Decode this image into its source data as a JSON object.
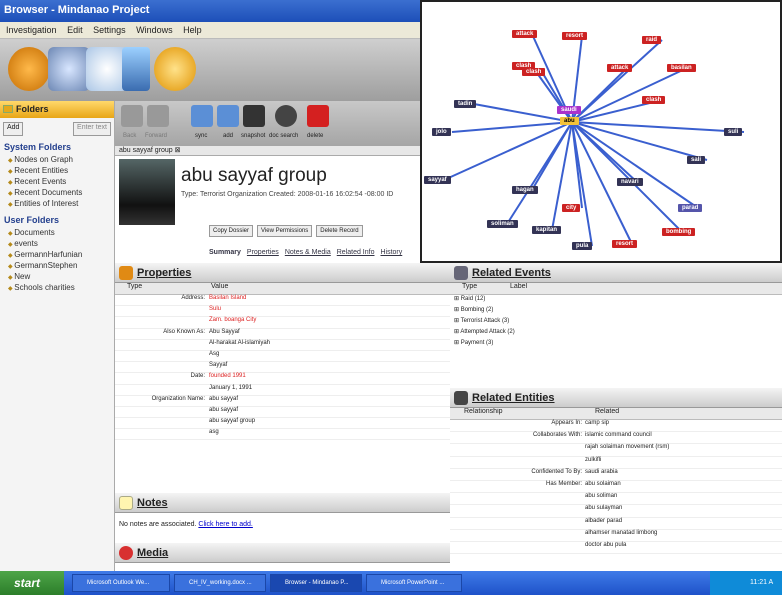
{
  "window": {
    "title": "Browser - Mindanao Project"
  },
  "menu": [
    "Investigation",
    "Edit",
    "Settings",
    "Windows",
    "Help"
  ],
  "sidebar": {
    "header": "Folders",
    "add_label": "Add",
    "filter_placeholder": "Enter text",
    "system_title": "System Folders",
    "system_items": [
      "Nodes on Graph",
      "Recent Entities",
      "Recent Events",
      "Recent Documents",
      "Entities of Interest"
    ],
    "user_title": "User Folders",
    "user_items": [
      "Documents",
      "events",
      "GermannHarfunian",
      "GermannStephen",
      "New",
      "Schools charities"
    ]
  },
  "detail": {
    "toolbar": [
      "Back",
      "Forward",
      "sync",
      "add",
      "snapshot",
      "doc search",
      "delete"
    ],
    "tab": "abu sayyaf group",
    "title": "abu sayyaf group",
    "meta": "Type: Terrorist Organization   Created: 2008-01-16 16:02:54 -08:00   ID",
    "buttons": [
      "Copy Dossier",
      "View Permissions",
      "Delete Record"
    ],
    "tabs": [
      "Summary",
      "Properties",
      "Notes & Media",
      "Related Info",
      "History"
    ]
  },
  "properties": {
    "title": "Properties",
    "columns": [
      "Type",
      "Value"
    ],
    "rows": [
      [
        "Address:",
        "Basilan Island",
        true
      ],
      [
        "",
        "Sulu",
        true
      ],
      [
        "",
        "Zam. boanga City",
        true
      ],
      [
        "Also Known As:",
        "Abu Sayyaf",
        false
      ],
      [
        "",
        "Al-harakat Al-islamiyah",
        false
      ],
      [
        "",
        "Asg",
        false
      ],
      [
        "",
        "Sayyaf",
        false
      ],
      [
        "Date:",
        "founded 1991",
        true
      ],
      [
        "",
        "January 1, 1991",
        false
      ],
      [
        "Organization Name:",
        "abu sayyaf",
        false
      ],
      [
        "",
        "abu sayyaf",
        false
      ],
      [
        "",
        "abu sayyaf group",
        false
      ],
      [
        "",
        "asg",
        false
      ]
    ]
  },
  "notes": {
    "title": "Notes",
    "text": "No notes are associated.",
    "link": "Click here to add."
  },
  "media": {
    "title": "Media"
  },
  "events": {
    "title": "Related Events",
    "columns": [
      "Type",
      "Label"
    ],
    "rows": [
      "Raid (12)",
      "Bombing (2)",
      "Terrorist Attack (3)",
      "Attempted Attack (2)",
      "Payment (3)"
    ]
  },
  "entities": {
    "title": "Related Entities",
    "columns": [
      "Relationship",
      "Related"
    ],
    "rows": [
      [
        "Appears In:",
        "camp sip"
      ],
      [
        "Collaborates With:",
        "islamic command council"
      ],
      [
        "",
        "rajah solaiman movement (rsm)"
      ],
      [
        "",
        "zulkifli"
      ],
      [
        "Confidented To By:",
        "saudi arabia"
      ],
      [
        "Has Member:",
        "abu solaiman"
      ],
      [
        "",
        "abu soliman"
      ],
      [
        "",
        "abu sulayman"
      ],
      [
        "",
        "albader parad"
      ],
      [
        "",
        "alhamser manatad limbong"
      ],
      [
        "",
        "doctor abu pula"
      ]
    ]
  },
  "graph": {
    "center": "abu",
    "nodes": [
      [
        "attack",
        "#c22"
      ],
      [
        "resort",
        "#c22"
      ],
      [
        "raid",
        "#c22"
      ],
      [
        "clash",
        "#c22"
      ],
      [
        "attack",
        "#c22"
      ],
      [
        "basilan",
        "#c22"
      ],
      [
        "clash",
        "#c22"
      ],
      [
        "clash",
        "#c22"
      ],
      [
        "saudi",
        "#a3c"
      ],
      [
        "tadin",
        "#335"
      ],
      [
        "jolo",
        "#335"
      ],
      [
        "sayyaf",
        "#335"
      ],
      [
        "suli",
        "#335"
      ],
      [
        "sali",
        "#335"
      ],
      [
        "navari",
        "#335"
      ],
      [
        "parad",
        "#55a"
      ],
      [
        "hagan",
        "#335"
      ],
      [
        "city",
        "#c22"
      ],
      [
        "soliman",
        "#335"
      ],
      [
        "kapitan",
        "#335"
      ],
      [
        "pula",
        "#335"
      ],
      [
        "resort",
        "#c22"
      ],
      [
        "bombing",
        "#c22"
      ]
    ]
  },
  "taskbar": {
    "start": "start",
    "tasks": [
      "Microsoft Outlook We...",
      "CH_IV_working.docx ...",
      "Browser - Mindanao P...",
      "Microsoft PowerPoint ..."
    ],
    "clock": "11:21 A"
  }
}
